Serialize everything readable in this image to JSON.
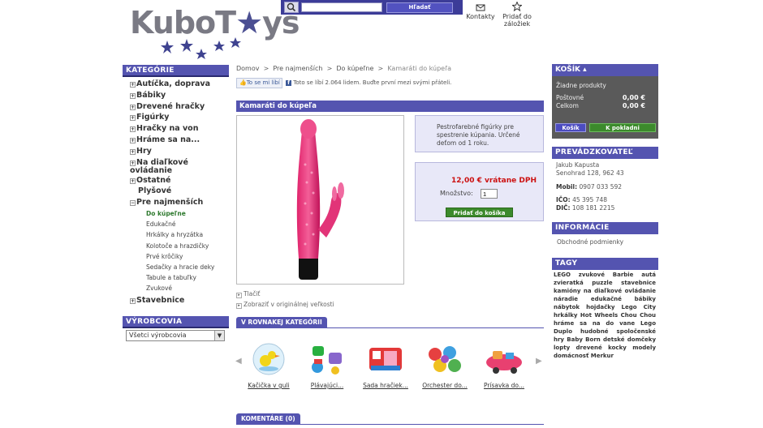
{
  "header": {
    "logo_text_part1": "Kubo",
    "logo_text_part2": "T",
    "logo_text_part3": "ys",
    "search_placeholder": "",
    "search_button": "Hľadať",
    "contacts": "Kontakty",
    "bookmark_line1": "Pridať do",
    "bookmark_line2": "záložiek"
  },
  "sidebar": {
    "categories_title": "KATEGÓRIE",
    "categories": [
      {
        "label": "Autíčka, doprava",
        "icon": "+"
      },
      {
        "label": "Bábiky",
        "icon": "+"
      },
      {
        "label": "Drevené hračky",
        "icon": "+"
      },
      {
        "label": "Figúrky",
        "icon": "+"
      },
      {
        "label": "Hračky na von",
        "icon": "+"
      },
      {
        "label": "Hráme sa na...",
        "icon": "+"
      },
      {
        "label": "Hry",
        "icon": "+"
      },
      {
        "label": "Na diaľkové ovládanie",
        "icon": "+"
      },
      {
        "label": "Ostatné",
        "icon": "+"
      },
      {
        "label": "Plyšové",
        "icon": ""
      },
      {
        "label": "Pre najmenších",
        "icon": "−"
      }
    ],
    "subcategories": [
      {
        "label": "Do kúpeľne",
        "active": true
      },
      {
        "label": "Edukačné",
        "active": false
      },
      {
        "label": "Hrkálky a hryzátka",
        "active": false
      },
      {
        "label": "Kolotoče a hrazdičky",
        "active": false
      },
      {
        "label": "Prvé krôčiky",
        "active": false
      },
      {
        "label": "Sedačky a hracie deky",
        "active": false
      },
      {
        "label": "Tabule a tabuľky",
        "active": false
      },
      {
        "label": "Zvukové",
        "active": false
      }
    ],
    "last_category": "Stavebnice",
    "makers_title": "VÝROBCOVIA",
    "makers_selected": "Všetci výrobcovia"
  },
  "breadcrumb": [
    "Domov",
    "Pre najmenších",
    "Do kúpeľne",
    "Kamaráti do kúpeľa"
  ],
  "facebook": {
    "like_label": "To se mi líbí",
    "like_text": "Toto se líbí 2.064 lidem. Buďte první mezi svými přáteli."
  },
  "product": {
    "title": "Kamaráti do kúpeľa",
    "description": "Pestrofarebné figúrky pre spestrenie kúpania. Určené deťom od 1 roku.",
    "price": "12,00 € vrátane DPH",
    "qty_label": "Množstvo:",
    "qty_value": "1",
    "add_button": "Pridať do košíka",
    "link_print": "Tlačiť",
    "link_original": "Zobraziť v originálnej veľkosti"
  },
  "same_category": {
    "tab_label": "V ROVNAKEJ KATEGÓRII",
    "items": [
      "Kačička v guli",
      "Plávajúci...",
      "Sada hračiek...",
      "Orchester do...",
      "Prísavka do..."
    ]
  },
  "comments_tab": "KOMENTÁRE (0)",
  "cart": {
    "title": "KOŠÍK",
    "empty": "Žiadne produkty",
    "shipping_label": "Poštovné",
    "shipping_value": "0,00 €",
    "total_label": "Celkom",
    "total_value": "0,00 €",
    "cart_button": "Košík",
    "checkout_button": "K pokladni"
  },
  "operator": {
    "title": "PREVÁDZKOVATEĽ",
    "name": "Jakub Kapusta",
    "address": "Senohrad 128, 962 43",
    "mobile_label": "Mobil:",
    "mobile": "0907 033 592",
    "ico_label": "IČO:",
    "ico": "45 395 748",
    "dic_label": "DIČ:",
    "dic": "108 181 2215"
  },
  "info": {
    "title": "INFORMÁCIE",
    "link": "Obchodné podmienky"
  },
  "tags": {
    "title": "TAGY",
    "items": [
      "LEGO",
      "zvukové",
      "Barbie",
      "autá",
      "zvieratká",
      "puzzle",
      "stavebnice",
      "kamióny",
      "na diaľkové ovládanie",
      "náradie",
      "edukačné",
      "bábiky",
      "nábytok",
      "hojdačky",
      "Lego",
      "City",
      "hrkálky",
      "Hot",
      "Wheels",
      "Chou",
      "Chou",
      "hráme",
      "sa",
      "na",
      "do",
      "vane",
      "Lego",
      "Duplo",
      "hudobné",
      "spoločenské",
      "hry",
      "Baby",
      "Born",
      "detské",
      "domčeky",
      "lopty",
      "drevené",
      "kocky",
      "modely",
      "domácnosť",
      "Merkur"
    ]
  },
  "colors": {
    "brand_blue": "#5454b0",
    "price_red": "#cc1111",
    "action_green": "#3c8a2c",
    "cart_gray": "#5a5a5a"
  }
}
